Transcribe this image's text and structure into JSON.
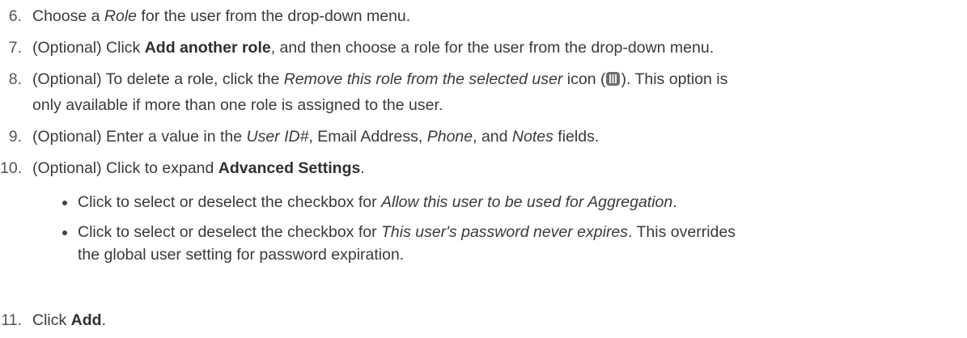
{
  "steps": [
    {
      "num": "6.",
      "parts": [
        "Choose a ",
        "Role",
        " for the user from the drop-down menu."
      ]
    },
    {
      "num": "7.",
      "parts": [
        "(Optional) Click ",
        "Add another role",
        ", and then choose a role for the user from the drop-down menu."
      ]
    },
    {
      "num": "8.",
      "parts": [
        "(Optional) To delete a role, click the ",
        "Remove this role from the selected user",
        " icon (",
        "). This option is"
      ],
      "line2": "only available if more than one role is assigned to the user."
    },
    {
      "num": "9.",
      "parts": [
        "(Optional) Enter a value in the ",
        "User ID#",
        ", Email Address, ",
        "Phone",
        ", and ",
        "Notes",
        " fields."
      ]
    },
    {
      "num": "10.",
      "parts": [
        "(Optional) Click to expand ",
        "Advanced Settings",
        "."
      ]
    },
    {
      "num": "11.",
      "parts": [
        "Click ",
        "Add",
        "."
      ]
    }
  ],
  "sub_bullets": [
    {
      "parts": [
        "Click to select or deselect the checkbox for ",
        "Allow this user to be used for Aggregation",
        "."
      ]
    },
    {
      "parts": [
        "Click to select or deselect the checkbox for ",
        "This user's password never expires",
        ". This overrides"
      ],
      "line2": "the global user setting for password expiration."
    }
  ],
  "icons": {
    "trash": "trash-icon"
  }
}
